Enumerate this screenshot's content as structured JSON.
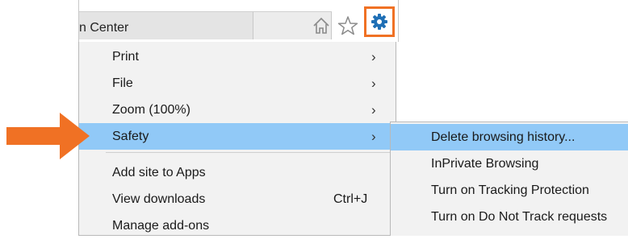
{
  "browser": {
    "tab_title": "n Center"
  },
  "toolbar": {
    "icons": [
      "home-icon",
      "favorites-star-icon",
      "tools-gear-icon"
    ],
    "gear_highlight_color": "#f07124"
  },
  "menu": {
    "items": [
      {
        "label": "Print",
        "submenu": true
      },
      {
        "label": "File",
        "submenu": true
      },
      {
        "label": "Zoom (100%)",
        "submenu": true
      },
      {
        "label": "Safety",
        "submenu": true,
        "highlighted": true
      },
      {
        "label": "Add site to Apps"
      },
      {
        "label": "View downloads",
        "shortcut": "Ctrl+J"
      },
      {
        "label": "Manage add-ons"
      }
    ],
    "highlight_color": "#91c9f7"
  },
  "safety_submenu": {
    "items": [
      {
        "label": "Delete browsing history...",
        "highlighted": true
      },
      {
        "label": "InPrivate Browsing"
      },
      {
        "label": "Turn on Tracking Protection"
      },
      {
        "label": "Turn on Do Not Track requests"
      }
    ]
  },
  "annotation": {
    "arrow_color": "#f07124"
  }
}
